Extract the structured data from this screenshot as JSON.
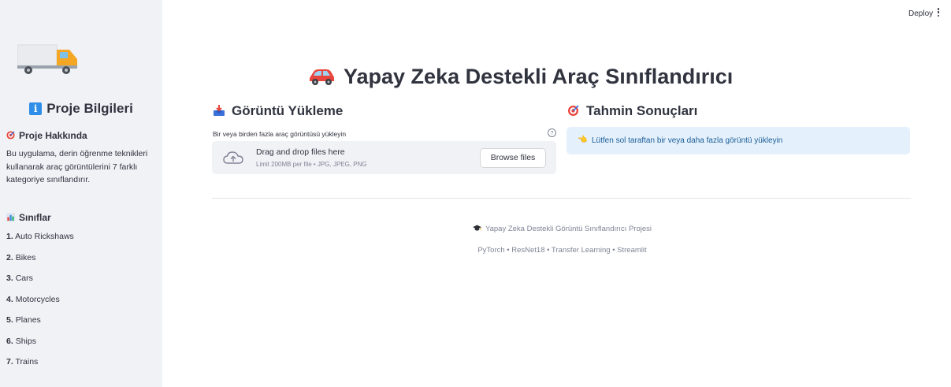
{
  "topbar": {
    "deploy_label": "Deploy",
    "menu_icon": "vertical-dots-icon"
  },
  "sidebar": {
    "logo_icon": "truck-icon",
    "title": "Proje Bilgileri",
    "title_icon": "info-icon",
    "about": {
      "heading": "Proje Hakkında",
      "heading_icon": "target-icon",
      "text": "Bu uygulama, derin öğrenme teknikleri kullanarak araç görüntülerini 7 farklı kategoriye sınıflandırır."
    },
    "classes": {
      "heading": "Sınıflar",
      "heading_icon": "bar-chart-icon",
      "items": [
        {
          "num": "1.",
          "label": "Auto Rickshaws"
        },
        {
          "num": "2.",
          "label": "Bikes"
        },
        {
          "num": "3.",
          "label": "Cars"
        },
        {
          "num": "4.",
          "label": "Motorcycles"
        },
        {
          "num": "5.",
          "label": "Planes"
        },
        {
          "num": "6.",
          "label": "Ships"
        },
        {
          "num": "7.",
          "label": "Trains"
        }
      ]
    }
  },
  "main": {
    "title": "Yapay Zeka Destekli Araç Sınıflandırıcı",
    "title_icon": "car-icon",
    "upload": {
      "heading": "Görüntü Yükleme",
      "heading_icon": "inbox-tray-icon",
      "label": "Bir veya birden fazla araç görüntüsü yükleyin",
      "help_icon": "question-circle-icon",
      "dropzone_main": "Drag and drop files here",
      "dropzone_sub": "Limit 200MB per file • JPG, JPEG, PNG",
      "browse_label": "Browse files"
    },
    "results": {
      "heading": "Tahmin Sonuçları",
      "heading_icon": "target-icon",
      "info_text": "Lütfen sol taraftan bir veya daha fazla görüntü yükleyin",
      "info_icon": "pointing-hand-icon"
    },
    "footer": {
      "line1": "Yapay Zeka Destekli Görüntü Sınıflandırıcı Projesi",
      "line1_icon": "graduation-cap-icon",
      "line2": "PyTorch • ResNet18 • Transfer Learning • Streamlit"
    }
  },
  "colors": {
    "sidebar_bg": "#f0f2f6",
    "info_bg": "#e4f1fc",
    "info_text": "#1a5c96",
    "text": "#31333f"
  }
}
